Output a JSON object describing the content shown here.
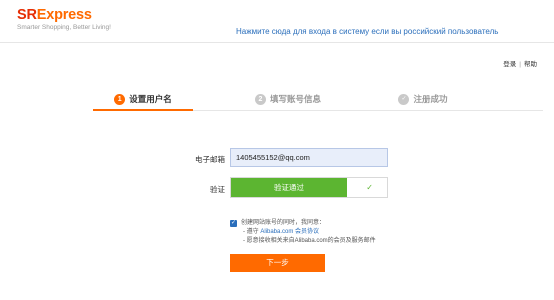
{
  "header": {
    "logo_sr": "SR",
    "logo_rest": "Express",
    "tagline": "Smarter Shopping, Better Living!",
    "ru_link": "Нажмите сюда для входа в систему если вы российский пользователь"
  },
  "top_links": {
    "login": "登录",
    "separator": "|",
    "help": "帮助"
  },
  "steps": [
    {
      "number": "1",
      "label": "设置用户名",
      "state": "active"
    },
    {
      "number": "2",
      "label": "填写账号信息",
      "state": "inactive"
    },
    {
      "number": "✓",
      "label": "注册成功",
      "state": "inactive"
    }
  ],
  "form": {
    "email_label": "电子邮箱",
    "email_value": "1405455152@qq.com",
    "verify_label": "验证",
    "verify_status": "验证通过",
    "verify_check": "✓"
  },
  "agreement": {
    "checked": true,
    "line1": "创建网站账号的同时，我同意：",
    "line2_prefix": "- 遵守 ",
    "line2_link": "Alibaba.com 会员协议",
    "line3": "- 愿意接收相关来自Alibaba.com的会员及服务邮件"
  },
  "next_button": "下一步",
  "colors": {
    "brand_red": "#e62e04",
    "brand_orange": "#ff6a00",
    "link_blue": "#2a6ebb",
    "verify_green": "#5cb531"
  }
}
